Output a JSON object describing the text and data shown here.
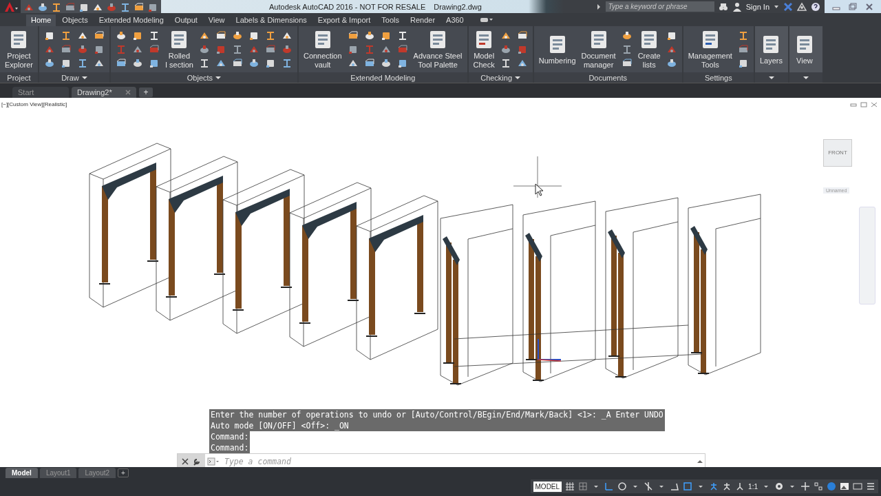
{
  "title_bar": {
    "title": "Autodesk AutoCAD 2016 - NOT FOR RESALE",
    "file_name": "Drawing2.dwg",
    "search": {
      "placeholder": "Type a keyword or phrase"
    },
    "sign_in": "Sign In"
  },
  "ribbon": {
    "tabs": [
      {
        "label": "Home",
        "selected": true
      },
      {
        "label": "Objects",
        "selected": false
      },
      {
        "label": "Extended Modeling",
        "selected": false
      },
      {
        "label": "Output",
        "selected": false
      },
      {
        "label": "View",
        "selected": false
      },
      {
        "label": "Labels & Dimensions",
        "selected": false
      },
      {
        "label": "Export & Import",
        "selected": false
      },
      {
        "label": "Tools",
        "selected": false
      },
      {
        "label": "Render",
        "selected": false
      },
      {
        "label": "A360",
        "selected": false
      }
    ],
    "panels": [
      {
        "title": "Project",
        "dropdown": false,
        "tools": [
          {
            "lines": [
              "Project",
              "Explorer"
            ]
          }
        ]
      },
      {
        "title": "Draw",
        "dropdown": true
      },
      {
        "title": "Objects",
        "dropdown": true,
        "tools": [
          {
            "lines": [
              "Rolled",
              "I section"
            ]
          }
        ]
      },
      {
        "title": "Extended Modeling",
        "dropdown": false,
        "tools": [
          {
            "lines": [
              "Connection",
              "vault"
            ]
          },
          {
            "lines": [
              "Advance Steel",
              "Tool Palette"
            ]
          }
        ]
      },
      {
        "title": "Checking",
        "dropdown": true,
        "tools": [
          {
            "lines": [
              "Model",
              "Check"
            ]
          }
        ]
      },
      {
        "title": "Documents",
        "dropdown": false,
        "tools": [
          {
            "lines": [
              "Numbering"
            ]
          },
          {
            "lines": [
              "Document",
              "manager"
            ]
          },
          {
            "lines": [
              "Create",
              "lists"
            ]
          }
        ]
      },
      {
        "title": "Settings",
        "dropdown": false,
        "tools": [
          {
            "lines": [
              "Management",
              "Tools"
            ]
          }
        ]
      },
      {
        "dropdown": true,
        "tools": [
          {
            "lines": [
              "Layers"
            ]
          }
        ]
      },
      {
        "dropdown": true,
        "tools": [
          {
            "lines": [
              "View"
            ]
          }
        ]
      }
    ]
  },
  "file_tabs": {
    "tabs": [
      {
        "label": "Start",
        "selected": false
      },
      {
        "label": "Drawing2*",
        "selected": true
      }
    ],
    "new_tab": "+"
  },
  "viewport": {
    "label": "[−][Custom View][Realistic]",
    "view_cube": {
      "face": "FRONT",
      "view_name": "Unnamed"
    }
  },
  "command_history": [
    "Enter the number of operations to undo or [Auto/Control/BEgin/End/Mark/Back] <1>: _A Enter UNDO",
    "Auto mode [ON/OFF] <Off>: _ON",
    "Command:",
    "Command:"
  ],
  "command_line": {
    "placeholder": "Type a command"
  },
  "layout_tabs": {
    "tabs": [
      {
        "label": "Model",
        "selected": true
      },
      {
        "label": "Layout1",
        "selected": false
      },
      {
        "label": "Layout2",
        "selected": false
      }
    ],
    "new_tab": "+"
  },
  "status_bar": {
    "mode": "MODEL",
    "scale": "1:1"
  }
}
